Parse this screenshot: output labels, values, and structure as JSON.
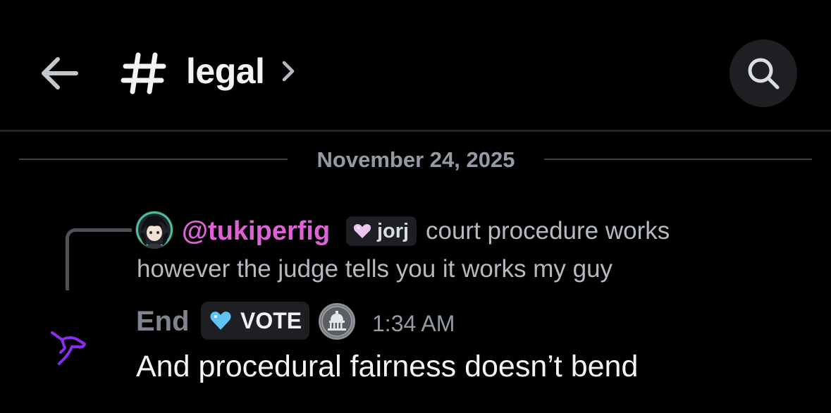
{
  "header": {
    "back_icon": "arrow-left-icon",
    "channel_icon": "hash-icon",
    "channel_name": "legal",
    "chevron_icon": "chevron-right-icon",
    "search_icon": "search-icon"
  },
  "date_separator": "November 24, 2025",
  "reply": {
    "username": "@tukiperfig",
    "tag": "jorj",
    "tag_icon": "pink-heart-icon",
    "text_line1": "court procedure works",
    "text_line2": "however the judge tells you it works my guy"
  },
  "message": {
    "author": "End",
    "tag": "VOTE",
    "tag_icon": "blue-heart-icon",
    "badge_icon": "capitol-seal-icon",
    "timestamp": "1:34 AM",
    "body": "And procedural fairness doesn’t bend"
  },
  "colors": {
    "background": "#000000",
    "reply_username": "#dd62d3",
    "author_muted": "#80848e",
    "accent_purple": "#8b2cf5",
    "pink_heart": "#e9c5f0",
    "blue_heart": "#5fc3f5"
  }
}
